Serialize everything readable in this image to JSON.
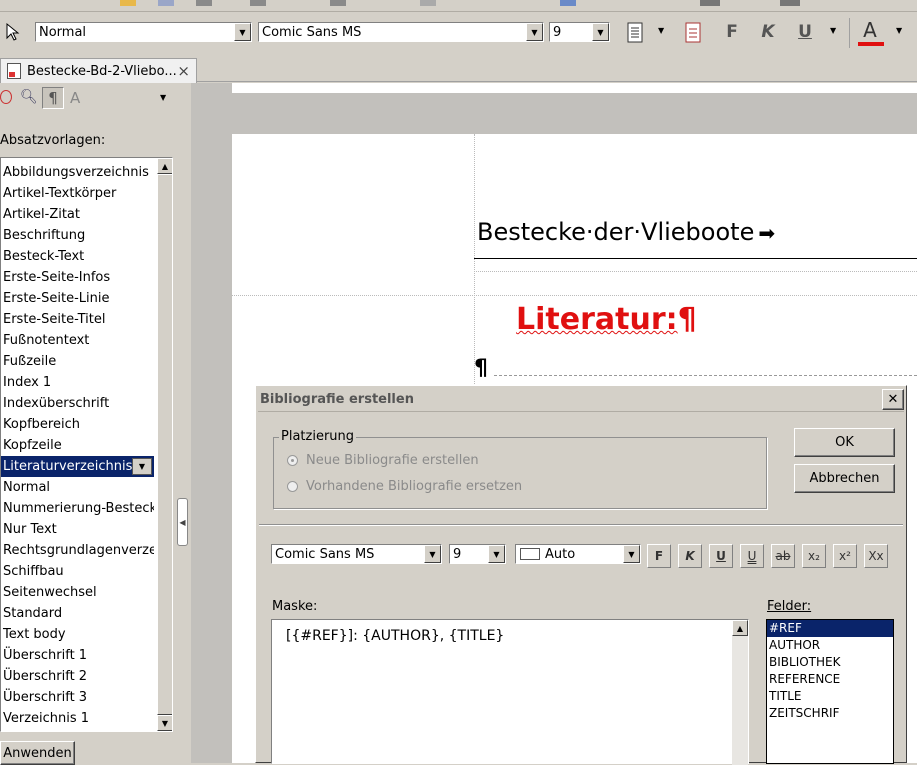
{
  "toolbar": {
    "style_value": "Normal",
    "font_value": "Comic Sans MS",
    "size_value": "9",
    "bold_label": "F",
    "italic_label": "K",
    "underline_label": "U",
    "font_color_label": "A",
    "font_color": "#e01010"
  },
  "tab": {
    "title": "Bestecke-Bd-2-Vliebo...",
    "close": "×"
  },
  "sidebar": {
    "heading": "Absatzvorlagen:",
    "items": [
      "Abbildungsverzeichnis",
      "Artikel-Textkörper",
      "Artikel-Zitat",
      "Beschriftung",
      "Besteck-Text",
      "Erste-Seite-Infos",
      "Erste-Seite-Linie",
      "Erste-Seite-Titel",
      "Fußnotentext",
      "Fußzeile",
      "Index 1",
      "Indexüberschrift",
      "Kopfbereich",
      "Kopfzeile",
      "Literaturverzeichnis",
      "Normal",
      "Nummerierung-Besteck",
      "Nur Text",
      "Rechtsgrundlagenverzeichnis",
      "Schiffbau",
      "Seitenwechsel",
      "Standard",
      "Text body",
      "Überschrift 1",
      "Überschrift 2",
      "Überschrift 3",
      "Verzeichnis 1"
    ],
    "selected_index": 14,
    "apply_button": "Anwenden"
  },
  "document": {
    "header_text": "Bestecke·der·Vlieboote",
    "heading_text": "Literatur:",
    "pilcrow": "¶",
    "heading_color": "#e01010"
  },
  "dialog": {
    "title": "Bibliografie erstellen",
    "close": "✕",
    "placement_group": "Platzierung",
    "option_new": "Neue Bibliografie erstellen",
    "option_replace": "Vorhandene Bibliografie ersetzen",
    "ok": "OK",
    "cancel": "Abbrechen",
    "font_value": "Comic Sans MS",
    "size_value": "9",
    "color_value": "Auto",
    "format_buttons": [
      "F",
      "K",
      "U",
      "U",
      "ab",
      "x₂",
      "x²",
      "Xx"
    ],
    "mask_label": "Maske:",
    "mask_value": "[{#REF}]: {AUTHOR}, {TITLE}",
    "fields_label": "Felder:",
    "fields": [
      "#REF",
      "AUTHOR",
      "BIBLIOTHEK",
      "REFERENCE",
      "TITLE",
      "ZEITSCHRIF"
    ],
    "fields_selected_index": 0
  }
}
